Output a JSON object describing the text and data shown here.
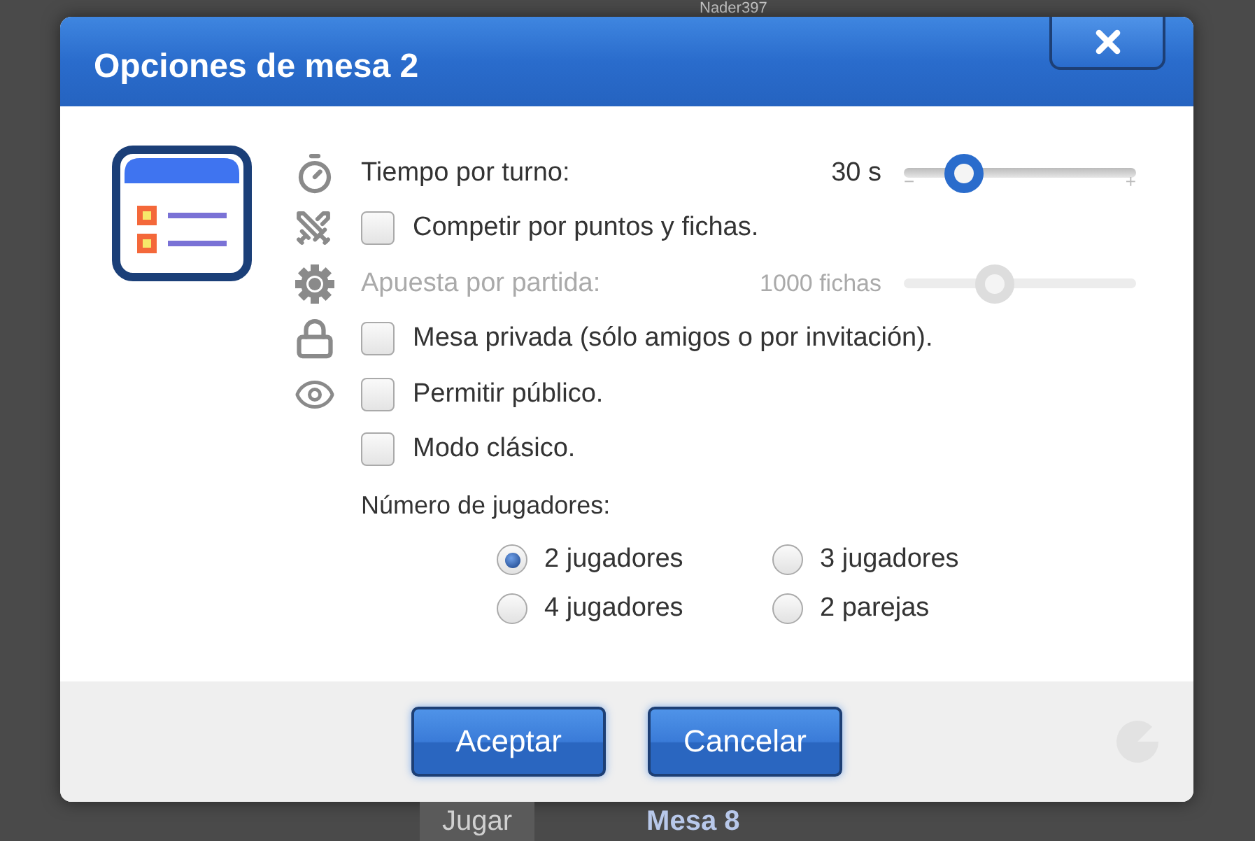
{
  "background": {
    "top_text": "Nader397",
    "bottom_button": "Jugar",
    "bottom_title": "Mesa 8"
  },
  "dialog": {
    "title": "Opciones de mesa 2",
    "options": [
      {
        "kind": "slider",
        "label": "Tiempo por turno:",
        "reading": "30 s",
        "level": 0.21,
        "disabled": false,
        "min_label": "−",
        "max_label": "+"
      },
      {
        "kind": "checkbox",
        "label": "Competir por puntos y fichas.",
        "checked": false
      },
      {
        "kind": "slider",
        "label": "Apuesta por partida:",
        "reading": "1000 fichas",
        "level": 0.37,
        "disabled": true
      },
      {
        "kind": "checkbox",
        "label": "Mesa privada (sólo amigos o por invitación).",
        "checked": false
      },
      {
        "kind": "checkbox",
        "label": "Permitir público.",
        "checked": false
      },
      {
        "kind": "checkbox",
        "label": "Modo clásico.",
        "checked": false
      }
    ],
    "players": {
      "label": "Número de jugadores:",
      "options": [
        {
          "label": "2 jugadores",
          "selected": true
        },
        {
          "label": "3 jugadores",
          "selected": false
        },
        {
          "label": "4 jugadores",
          "selected": false
        },
        {
          "label": "2 parejas",
          "selected": false
        }
      ]
    },
    "buttons": [
      "Aceptar",
      "Cancelar"
    ]
  }
}
